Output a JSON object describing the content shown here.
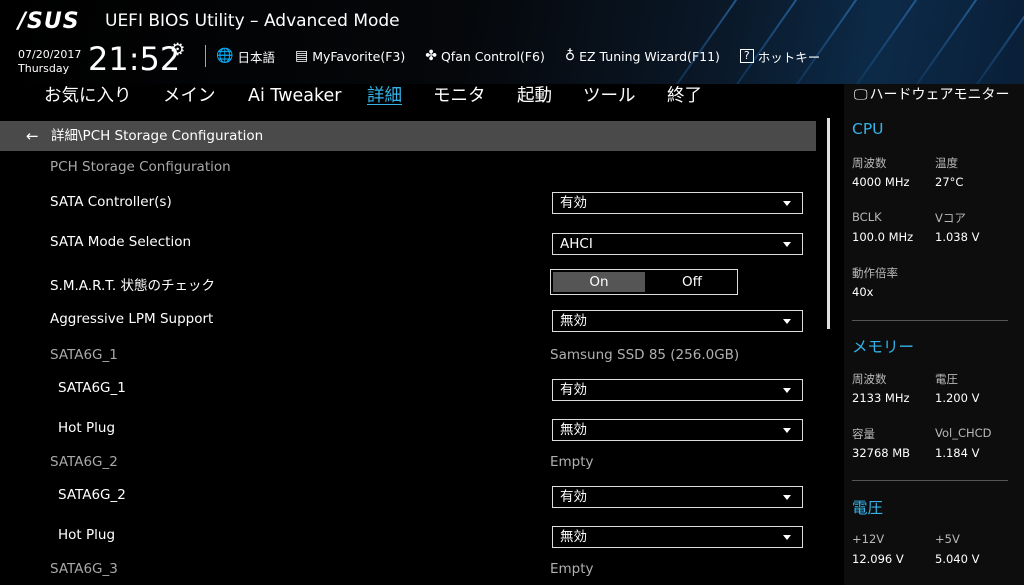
{
  "header": {
    "logo": "/SUS",
    "title": "UEFI BIOS Utility – Advanced Mode",
    "date": "07/20/2017",
    "day": "Thursday",
    "time": "21:52",
    "toolbar": [
      {
        "icon": "globe-icon",
        "glyph": "🌐",
        "label": "日本語"
      },
      {
        "icon": "favorite-list-icon",
        "glyph": "▤",
        "label": "MyFavorite(F3)"
      },
      {
        "icon": "fan-icon",
        "glyph": "✤",
        "label": "Qfan Control(F6)"
      },
      {
        "icon": "lightbulb-icon",
        "glyph": "♁",
        "label": "EZ Tuning Wizard(F11)"
      },
      {
        "icon": "help-box-icon",
        "glyph": "?",
        "label": "ホットキー"
      }
    ]
  },
  "menu": {
    "items": [
      "お気に入り",
      "メイン",
      "Ai Tweaker",
      "詳細",
      "モニタ",
      "起動",
      "ツール",
      "終了"
    ],
    "active_index": 3
  },
  "breadcrumb": "詳細\\PCH Storage Configuration",
  "content": {
    "section_title": "PCH Storage Configuration",
    "sata_controller": {
      "label": "SATA Controller(s)",
      "value": "有効"
    },
    "sata_mode": {
      "label": "SATA Mode Selection",
      "value": "AHCI"
    },
    "smart": {
      "label": "S.M.A.R.T. 状態のチェック",
      "on": "On",
      "off": "Off",
      "selected": "On"
    },
    "aggressive_lpm": {
      "label": "Aggressive LPM Support",
      "value": "無効"
    },
    "ports": [
      {
        "name": "SATA6G_1",
        "device": "Samsung SSD 85 (256.0GB)",
        "port_label": "SATA6G_1",
        "port_value": "有効",
        "hotplug_label": "Hot Plug",
        "hotplug_value": "無効"
      },
      {
        "name": "SATA6G_2",
        "device": "Empty",
        "port_label": "SATA6G_2",
        "port_value": "有効",
        "hotplug_label": "Hot Plug",
        "hotplug_value": "無効"
      },
      {
        "name": "SATA6G_3",
        "device": "Empty"
      }
    ]
  },
  "monitor": {
    "title": "ハードウェアモニター",
    "cpu": {
      "title": "CPU",
      "freq_label": "周波数",
      "freq": "4000 MHz",
      "temp_label": "温度",
      "temp": "27°C",
      "bclk_label": "BCLK",
      "bclk": "100.0 MHz",
      "vcore_label": "Vコア",
      "vcore": "1.038 V",
      "ratio_label": "動作倍率",
      "ratio": "40x"
    },
    "memory": {
      "title": "メモリー",
      "freq_label": "周波数",
      "freq": "2133 MHz",
      "volt_label": "電圧",
      "volt": "1.200 V",
      "cap_label": "容量",
      "cap": "32768 MB",
      "vol_chcd_label": "Vol_CHCD",
      "vol_chcd": "1.184 V"
    },
    "voltage": {
      "title": "電圧",
      "v12_label": "+12V",
      "v12": "12.096 V",
      "v5_label": "+5V",
      "v5": "5.040 V"
    }
  }
}
